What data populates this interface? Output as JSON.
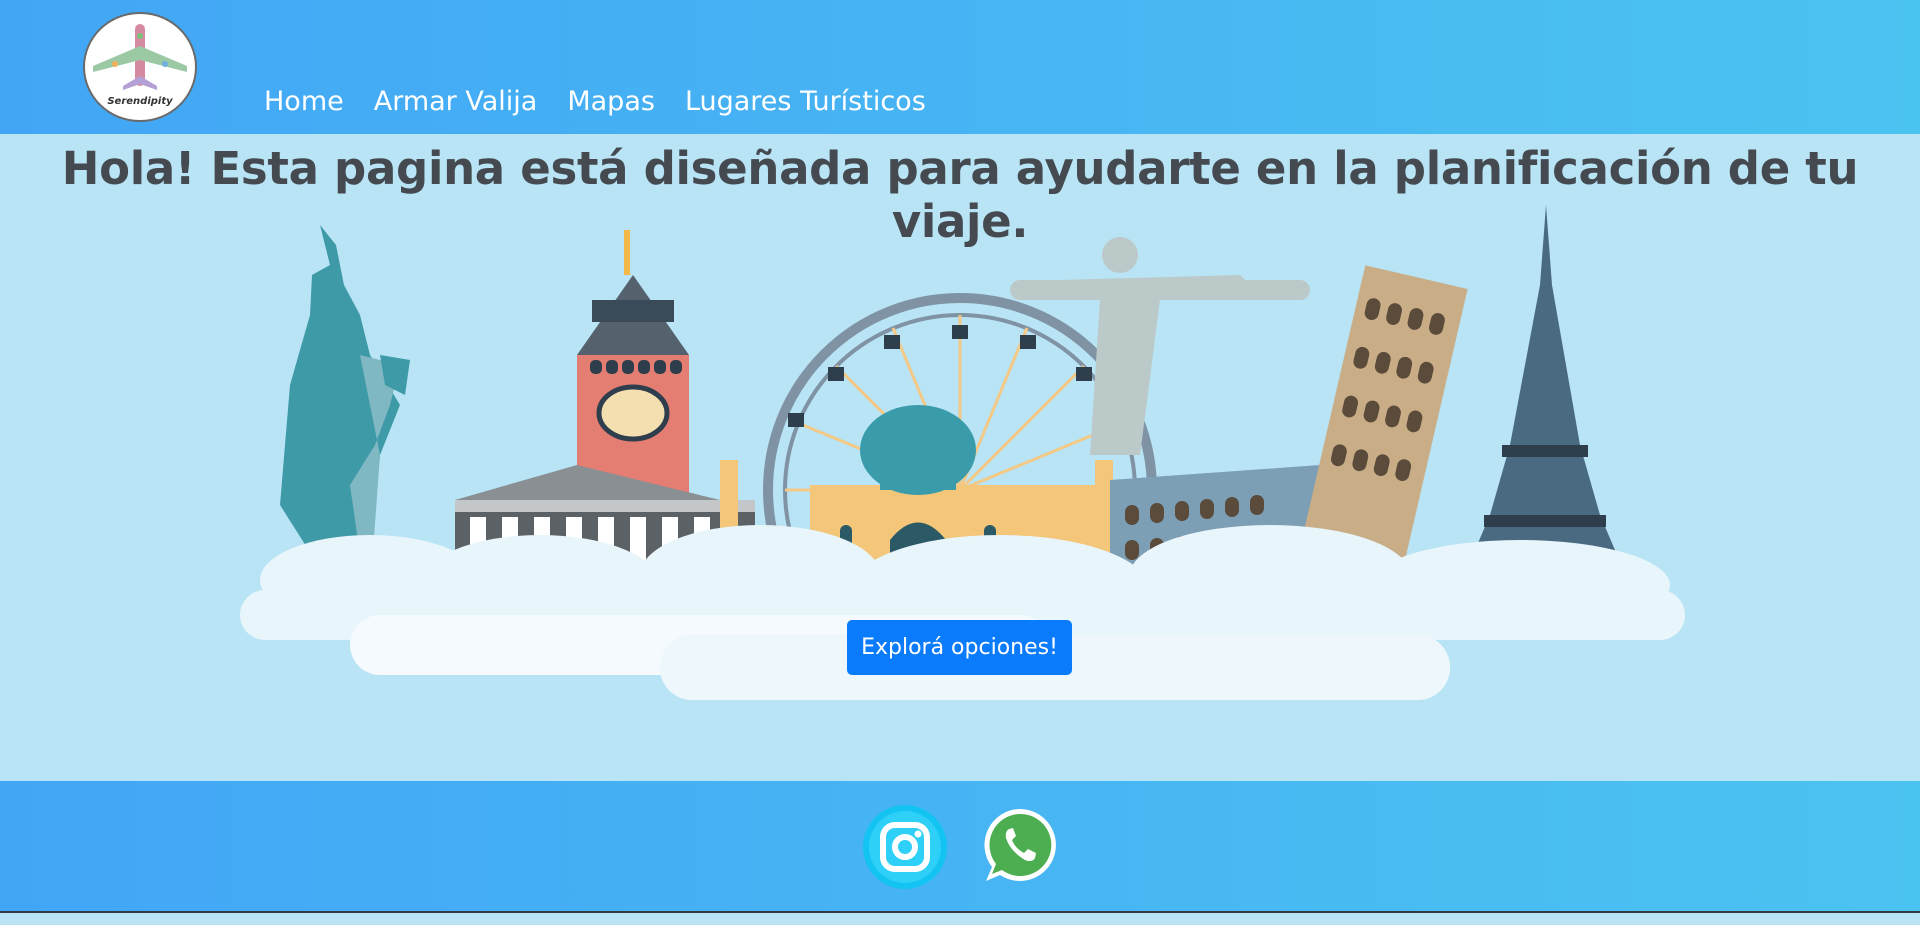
{
  "brand": {
    "logo_text": "Serendipity"
  },
  "nav": {
    "items": [
      {
        "label": "Home"
      },
      {
        "label": "Armar Valija"
      },
      {
        "label": "Mapas"
      },
      {
        "label": "Lugares Turísticos"
      }
    ]
  },
  "hero": {
    "title": "Hola! Esta pagina está diseñada para ayudarte en la planificación de tu viaje.",
    "cta_label": "Explorá opciones!"
  },
  "footer": {
    "icons": [
      "instagram-icon",
      "whatsapp-icon"
    ]
  },
  "colors": {
    "header_gradient_start": "#42a6f6",
    "header_gradient_end": "#4bc3f1",
    "hero_background": "#b8e4f5",
    "button": "#0a7bfb",
    "title_text": "#444a50"
  }
}
